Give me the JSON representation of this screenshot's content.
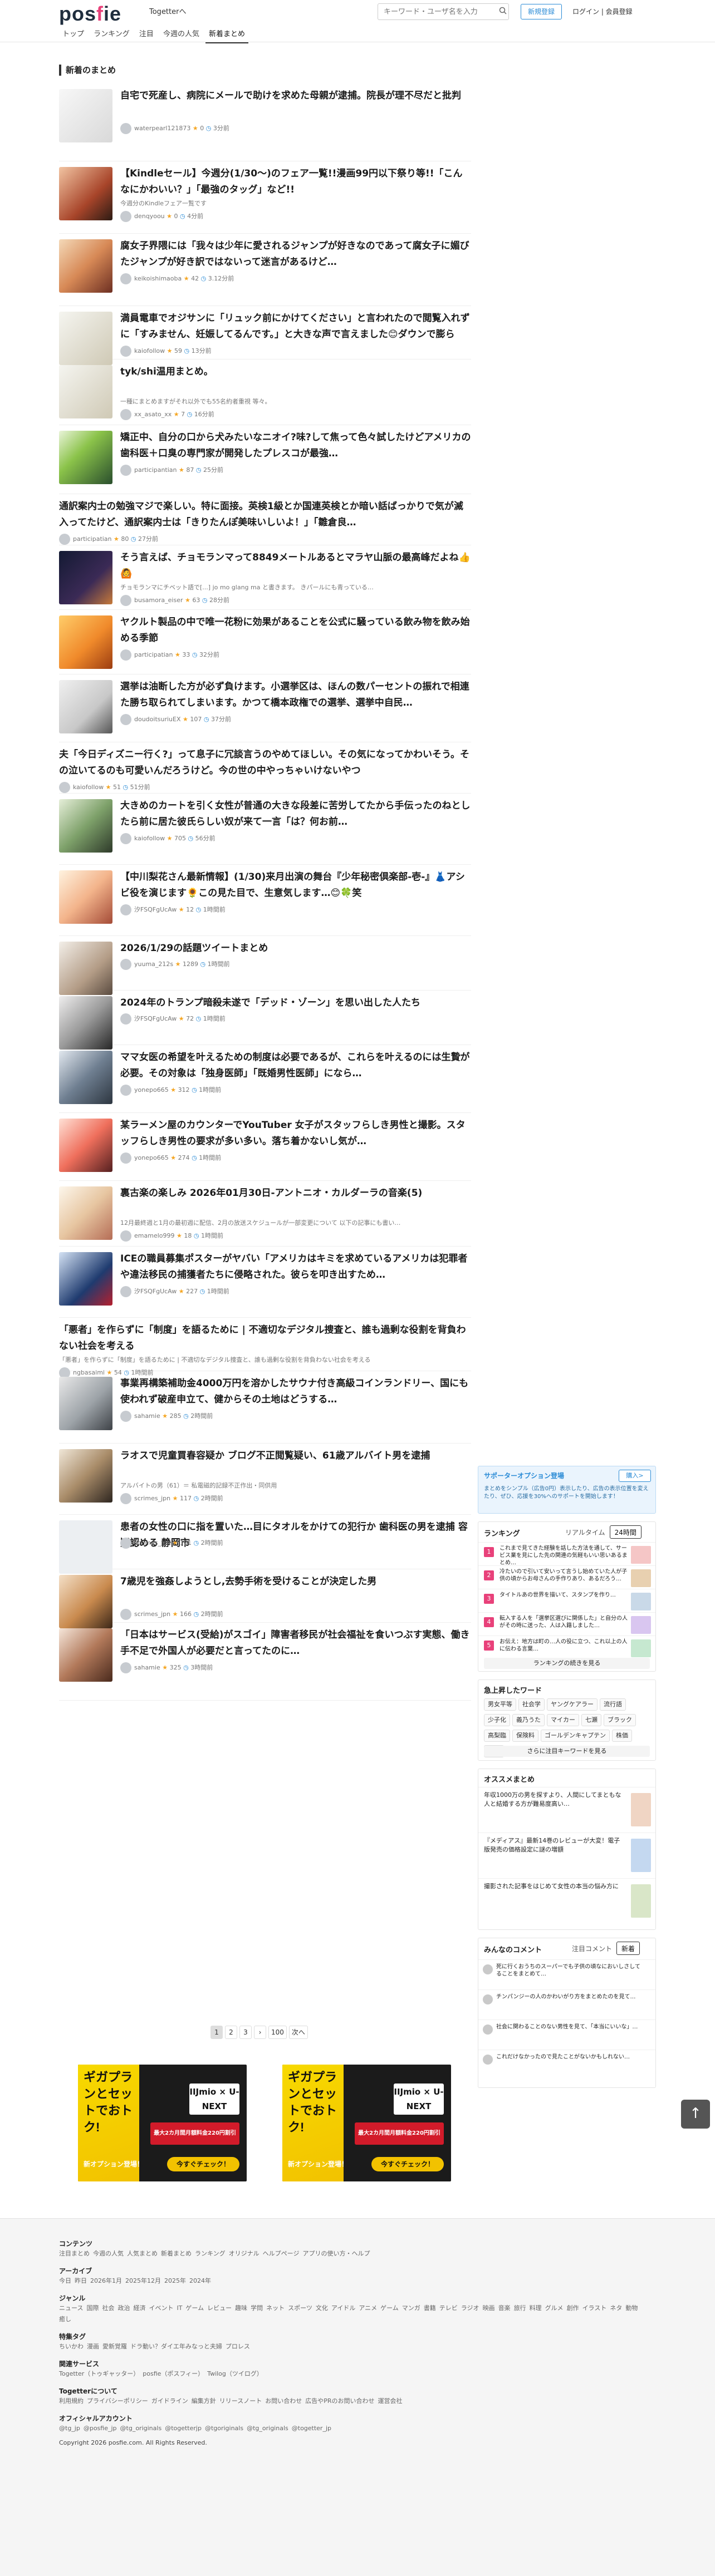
{
  "header": {
    "logo": "posfie",
    "logo_sub": "Togetterへ",
    "search_placeholder": "キーワード・ユーザ名を入力",
    "register": "新規登録",
    "login": "ログイン | 会員登録",
    "nav": [
      "トップ",
      "ランキング",
      "注目",
      "今週の人気",
      "新着まとめ"
    ]
  },
  "main": {
    "section_title": "新着のまとめ",
    "items": [
      {
        "title": "自宅で死産し、病院にメールで助けを求めた母親が逮捕。院長が理不尽だと批判",
        "sub": "",
        "user": "waterpearl121873",
        "stats": "0",
        "time": "3分前"
      },
      {
        "title": "【Kindleセール】今週分(1/30〜)のフェア一覧!!漫画99円以下祭り等!!「こんなにかわいい？」「最強のタッグ」など!!",
        "sub": "今週分のKindleフェア一覧です",
        "user": "denqyoou",
        "stats": "0",
        "time": "4分前"
      },
      {
        "title": "腐女子界隈には「我々は少年に愛されるジャンプが好きなのであって腐女子に媚びたジャンプが好き訳ではないって迷言があるけど…",
        "sub": "",
        "user": "keikoishimaoba",
        "stats": "42",
        "time": "3.12分前"
      },
      {
        "title": "満員電車でオジサンに「リュック前にかけてください」と言われたので閲覧入れずに「すみません、妊娠してるんです。」と大きな声で言えました😊ダウンで膨らみ…",
        "sub": "",
        "user": "kaiofollow",
        "stats": "59",
        "time": "13分前"
      },
      {
        "title": "tyk/shi温用まとめ。",
        "sub": "一種にまとめますがそれ以外でも55名約者重視 等々。",
        "user": "xx_asato_xx",
        "stats": "7",
        "time": "16分前"
      },
      {
        "title": "矯正中、自分の口から犬みたいなニオイ?味?して焦って色々試したけどアメリカの歯科医＋口臭の専門家が開発したプレスコが最強…",
        "sub": "",
        "user": "participantian",
        "stats": "87",
        "time": "25分前"
      },
      {
        "title": "通訳案内士の勉強マジで楽しい。特に面接。英検1級とか国連英検とか暗い話ばっかりで気が滅入ってたけど、通訳案内士は「きりたんぽ美味いしいよ！」「雛倉良…",
        "sub": "",
        "user": "participatian",
        "stats": "80",
        "time": "27分前"
      },
      {
        "title": "そう言えば、チョモランマって8849メートルあるとマラヤ山脈の最高峰だよね👍🙆",
        "sub": "チョモランマにチベット語で[...] jo mo glang ma と書きます。 きパールにも青っている…",
        "user": "busamora_eiser",
        "stats": "63",
        "time": "28分前"
      },
      {
        "title": "ヤクルト製品の中で唯一花粉に効果があることを公式に騒っている飲み物を飲み始める季節",
        "sub": "",
        "user": "participatian",
        "stats": "33",
        "time": "32分前"
      },
      {
        "title": "選挙は油断した方が必ず負けます。小選挙区は、ほんの数パーセントの振れで相連た勝ち取られてしまいます。かつて橋本政権での選挙、選挙中自民…",
        "sub": "",
        "user": "doudoitsuriuEX",
        "stats": "107",
        "time": "37分前"
      },
      {
        "title": "夫「今日ディズニー行く?」って息子に冗談言うのやめてほしい。その気になってかわいそう。その泣いてるのも可愛いんだろうけど。今の世の中やっちゃいけないやつ",
        "sub": "",
        "user": "kaiofollow",
        "stats": "51",
        "time": "51分前"
      },
      {
        "title": "大きめのカートを引く女性が普通の大きな段差に苦労してたから手伝ったのねとしたら前に居た彼氏らしい奴が来て一言「は？何お前…",
        "sub": "",
        "user": "kaiofollow",
        "stats": "705",
        "time": "56分前"
      },
      {
        "title": "【中川梨花さん最新情報】(1/30)来月出演の舞台『少年秘密倶楽部-壱-』👗アシビ役を演じます🌻この見た目で、生意気します…😊🍀笑",
        "sub": "",
        "user": "汐FSQFgUcAw",
        "stats": "12",
        "time": "1時間前"
      },
      {
        "title": "2026/1/29の話題ツイートまとめ",
        "sub": "",
        "user": "yuuma_212s",
        "stats": "1289",
        "time": "1時間前"
      },
      {
        "title": "2024年のトランプ暗殺未遂で「デッド・ゾーン」を思い出した人たち",
        "sub": "",
        "user": "汐FSQFgUcAw",
        "stats": "72",
        "time": "1時間前"
      },
      {
        "title": "ママ女医の希望を叶えるための制度は必要であるが、これらを叶えるのには生贄が必要。その対象は「独身医師」「既婚男性医師」になら…",
        "sub": "",
        "user": "yonepo665",
        "stats": "312",
        "time": "1時間前"
      },
      {
        "title": "某ラーメン屋のカウンターでYouTuber 女子がスタッフらしき男性と撮影。スタッフらしき男性の要求が多い多い。落ち着かないし気が…",
        "sub": "",
        "user": "yonepo665",
        "stats": "274",
        "time": "1時間前"
      },
      {
        "title": "裏古楽の楽しみ 2026年01月30日-アントニオ・カルダーラの音楽(5)",
        "sub": "12月最終週と1月の最初週に配信、2月の放送スケジュールが一部変更について 以下の記事にも書い…",
        "user": "emamelo999",
        "stats": "18",
        "time": "1時間前"
      },
      {
        "title": "ICEの職員募集ポスターがヤバい「アメリカはキミを求めているアメリカは犯罪者や違法移民の捕獲者たちに侵略された。彼らを叩き出すため…",
        "sub": "",
        "user": "汐FSQFgUcAw",
        "stats": "227",
        "time": "1時間前"
      },
      {
        "title": "「悪者」を作らずに「制度」を語るために | 不適切なデジタル捜査と、誰も過剰な役割を背負わない社会を考える",
        "sub": "「悪者」を作らずに「制度」を語るために | 不適切なデジタル捜査と、誰も過剰な役割を背負わない社会を考える",
        "user": "ngbasaimi",
        "stats": "54",
        "time": "1時間前"
      },
      {
        "title": "事業再構築補助金4000万円を溶かしたサウナ付き高級コインランドリー、国にも使われず破産申立て、健からその土地はどうする…",
        "sub": "",
        "user": "sahamie",
        "stats": "285",
        "time": "2時間前"
      },
      {
        "title": "ラオスで児童買春容疑か ブログ不正閲覧疑い、61歳アルバイト男を逮捕",
        "sub": "アルバイトの男（61）＝ 私電磁的記録不正作出・同供用",
        "user": "scrimes_jpn",
        "stats": "117",
        "time": "2時間前"
      },
      {
        "title": "患者の女性の口に指を置いた…目にタオルをかけての犯行か 歯科医の男を逮捕 容疑認める 静岡市",
        "sub": "",
        "user": "scrimes_jpn",
        "stats": "101",
        "time": "2時間前"
      },
      {
        "title": "7歳児を強姦しようとし,去勢手術を受けることが決定した男",
        "sub": "",
        "user": "scrimes_jpn",
        "stats": "166",
        "time": "2時間前"
      },
      {
        "title": "「日本はサービス(受給)がスゴイ」障害者移民が社会福祉を食いつぶす実態、働き手不足で外国人が必要だと言ってたのに…",
        "sub": "",
        "user": "sahamie",
        "stats": "325",
        "time": "3時間前"
      }
    ],
    "pager": [
      "1",
      "2",
      "3",
      "›",
      "100",
      "次へ"
    ],
    "ad": {
      "headline": "ギガプランとセットでおトク!",
      "brand": "IIJmio × U-NEXT",
      "price": "最大2カ月間月額料金220円割引",
      "new": "新オプション登場！",
      "check": "今すぐチェック！"
    }
  },
  "sidebar": {
    "premium_title": "サポーターオプション登場",
    "premium_btn": "購入>",
    "premium_text": "まとめをシンプル（広告0円）表示したり、広告の表示位置を変えたり、ぜひ、応援を30%へのサポートを開始します！",
    "ranking_title": "ランキング",
    "ranking_tabs": [
      "リアルタイム",
      "24時間"
    ],
    "ranking": [
      "これまで見てきた経験を話した方法を通して、サービス業を見にした先の関連の気軽もいい思いあるまとめ…",
      "冷たいので引いて安いって言うし始めていた人が子供の頃からお母さんの手作りあり、あるだろう…",
      "タイトルあの世界を描いて、スタンプを作り…",
      "転入する人を「選挙区選びに関係した」と自分の人がその時に送った、人は入籍しました…",
      "お伝え：地方は町の…人の役に立つ、これ以上の人に伝わる言葉…"
    ],
    "ranking_more": "ランキングの続きを見る",
    "keywords_title": "急上昇したワード",
    "keywords": [
      "男女平等",
      "社会学",
      "ヤングケアラー",
      "流行語",
      "少子化",
      "義乃うた",
      "マイカー",
      "七瀬",
      "ブラック",
      "高梨臨",
      "保険料",
      "ゴールデンキャプテン",
      "株価",
      "電話"
    ],
    "keywords_more": "さらに注目キーワードを見る",
    "recommend_title": "オススメまとめ",
    "recommend": [
      "年収1000万の男を探すより、人間にしてまともな人と結婚する方が難易度高い…",
      "『メディアス』最新14巻のレビューが大変！電子版発売の価格設定に謎の増額",
      "撮影された記事をはじめて女性の本当の悩み方に"
    ],
    "comments_title": "みんなのコメント",
    "comments_tabs": [
      "注目コメント",
      "新着"
    ],
    "comments": [
      "死に行くおうちのスーパーでも子供の頃なにおいしさしてることをまとめて…",
      "チンパンジーの人のかわいがり方をまとめたのを見て…",
      "社会に関わることのない男性を見て、「本当にいいな」…",
      "これだけなかったので見たことがないかもしれない…"
    ]
  },
  "footer": {
    "content_h": "コンテンツ",
    "content_links": [
      "注目まとめ",
      "今週の人気",
      "人気まとめ",
      "新着まとめ",
      "ランキング",
      "オリジナル",
      "ヘルプページ",
      "アプリの使い方・ヘルプ"
    ],
    "archive_h": "アーカイブ",
    "archive_links": [
      "今日",
      "昨日",
      "2026年1月",
      "2025年12月",
      "2025年",
      "2024年"
    ],
    "genre_h": "ジャンル",
    "genre_links": [
      "ニュース",
      "国際",
      "社会",
      "政治",
      "経済",
      "イベント",
      "IT",
      "ゲーム",
      "レビュー",
      "趣味",
      "学問",
      "ネット",
      "スポーツ",
      "文化",
      "アイドル",
      "アニメ",
      "ゲーム",
      "マンガ",
      "書籍",
      "テレビ",
      "ラジオ",
      "映画",
      "音楽",
      "旅行",
      "料理",
      "グルメ",
      "創作",
      "イラスト",
      "ネタ",
      "動物",
      "癒し"
    ],
    "special_h": "特集タグ",
    "special_links": [
      "ちいかわ",
      "漫画",
      "愛新覚羅",
      "ドラ動い？ダイエ年みなっと夫婦",
      "プロレス"
    ],
    "related_h": "関連サービス",
    "related_links": [
      "Togetter（トゥギャッター）",
      "posfie（ポスフィー）",
      "Twilog（ツイログ）"
    ],
    "about_h": "Togetterについて",
    "about_links": [
      "利用規約",
      "プライバシーポリシー",
      "ガイドライン",
      "編集方針",
      "リリースノート",
      "お問い合わせ",
      "広告やPRのお問い合わせ",
      "運営会社"
    ],
    "official_h": "オフィシャルアカウント",
    "official_links": [
      "@tg_jp",
      "@posfie_jp",
      "@tg_originals",
      "@togetterjp",
      "@tgoriginals",
      "@tg_originals",
      "@togetter_jp"
    ],
    "copyright": "Copyright 2026 posfie.com. All Rights Reserved."
  }
}
